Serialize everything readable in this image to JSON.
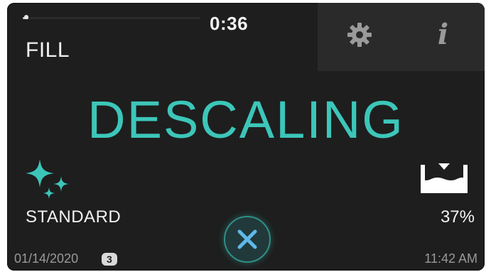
{
  "status": {
    "timer": "0:36",
    "step": "FILL",
    "progress_fraction": 0.03
  },
  "top_buttons": {
    "settings_icon": "gear-icon",
    "info_label": "i"
  },
  "main": {
    "title": "DESCALING",
    "title_color": "#3cc6b9"
  },
  "mode": {
    "icon": "sparkles-icon",
    "label": "STANDARD"
  },
  "level": {
    "icon": "water-level-icon",
    "value": "37%"
  },
  "cancel": {
    "icon": "close-icon"
  },
  "footer": {
    "date": "01/14/2020",
    "badge": "3",
    "time": "11:42 AM"
  }
}
